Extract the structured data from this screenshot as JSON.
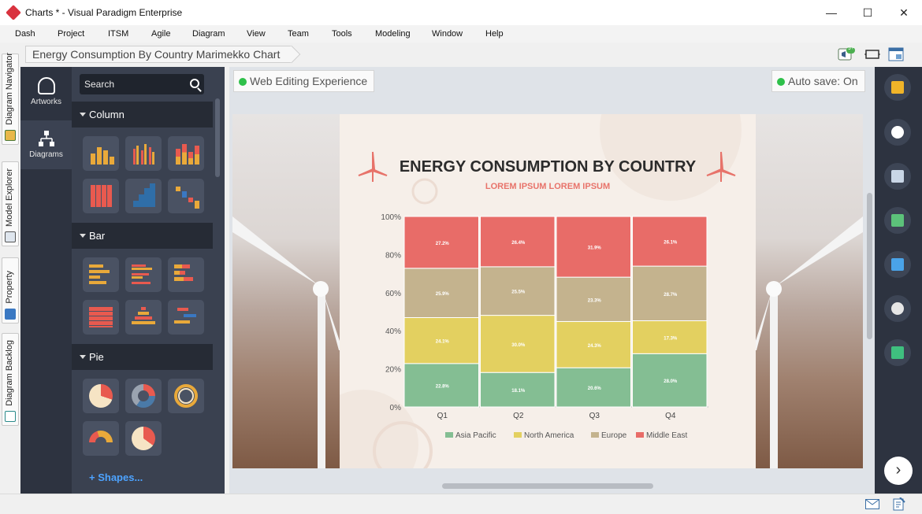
{
  "window": {
    "title": "Charts * - Visual Paradigm Enterprise",
    "minimize_label": "—",
    "maximize_label": "☐",
    "close_label": "✕"
  },
  "menu": [
    "Dash",
    "Project",
    "ITSM",
    "Agile",
    "Diagram",
    "View",
    "Team",
    "Tools",
    "Modeling",
    "Window",
    "Help"
  ],
  "breadcrumb": "Energy Consumption By Country Marimekko Chart",
  "notifications_badge": "9+",
  "left_tabs": [
    "Diagram Navigator",
    "Model Explorer",
    "Property",
    "Diagram Backlog"
  ],
  "rail": {
    "artworks_label": "Artworks",
    "diagrams_label": "Diagrams"
  },
  "palette": {
    "search_placeholder": "Search",
    "categories": [
      "Column",
      "Bar",
      "Pie"
    ],
    "shapes_link": "+ Shapes..."
  },
  "canvas": {
    "web_editing_label": "Web Editing Experience",
    "autosave_label": "Auto save: On"
  },
  "colors": {
    "asia_pacific": "#84be93",
    "north_america": "#e3d060",
    "europe": "#c4b38e",
    "middle_east": "#e86c68",
    "title": "#2b2b2b",
    "subtitle": "#e8736a"
  },
  "chart_data": {
    "type": "bar",
    "title": "ENERGY CONSUMPTION BY COUNTRY",
    "subtitle": "LOREM IPSUM LOREM IPSUM",
    "stacked": "percent",
    "categories": [
      "Q1",
      "Q2",
      "Q3",
      "Q4"
    ],
    "yticks": [
      "100%",
      "80%",
      "60%",
      "40%",
      "20%",
      "0%"
    ],
    "ylim": [
      0,
      100
    ],
    "legend_position": "bottom",
    "series": [
      {
        "name": "Asia Pacific",
        "values": [
          22.8,
          18.1,
          20.6,
          28.0
        ],
        "labels": [
          "22.8%",
          "18.1%",
          "20.6%",
          "28.0%"
        ]
      },
      {
        "name": "North America",
        "values": [
          24.1,
          30.0,
          24.3,
          17.3
        ],
        "labels": [
          "24.1%",
          "30.0%",
          "24.3%",
          "17.3%"
        ]
      },
      {
        "name": "Europe",
        "values": [
          25.9,
          25.5,
          23.3,
          28.7
        ],
        "labels": [
          "25.9%",
          "25.5%",
          "23.3%",
          "28.7%"
        ]
      },
      {
        "name": "Middle East",
        "values": [
          27.2,
          26.4,
          31.9,
          26.1
        ],
        "labels": [
          "27.2%",
          "26.4%",
          "31.9%",
          "26.1%"
        ]
      }
    ]
  }
}
